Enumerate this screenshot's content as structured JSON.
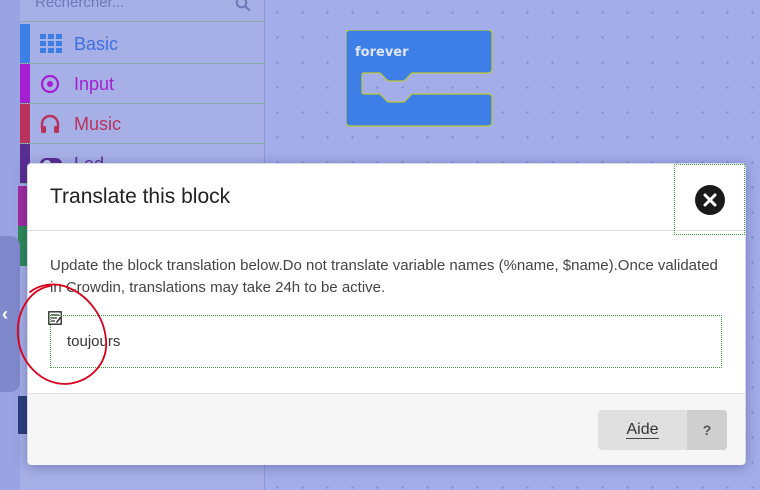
{
  "sidebar": {
    "search_placeholder": "Rechercher...",
    "categories": [
      {
        "label": "Basic",
        "color": "#1e90ff",
        "icon": "grid-icon"
      },
      {
        "label": "Input",
        "color": "#b620e0",
        "icon": "target-icon"
      },
      {
        "label": "Music",
        "color": "#c0345a",
        "icon": "headphones-icon"
      },
      {
        "label": "Led",
        "color": "#5c2d91",
        "icon": "toggle-icon"
      }
    ]
  },
  "workspace": {
    "forever_block_label": "forever",
    "block_color": "#3d7fe6"
  },
  "modal": {
    "title": "Translate this block",
    "description": "Update the block translation below.Do not translate variable names (%name, $name).Once validated in Crowdin, translations may take 24h to be active.",
    "input_value": "toujours",
    "help_button_label": "Aide",
    "help_question_label": "?"
  },
  "colors": {
    "annotation": "#d9001b",
    "overlay": "#8f9be0"
  }
}
